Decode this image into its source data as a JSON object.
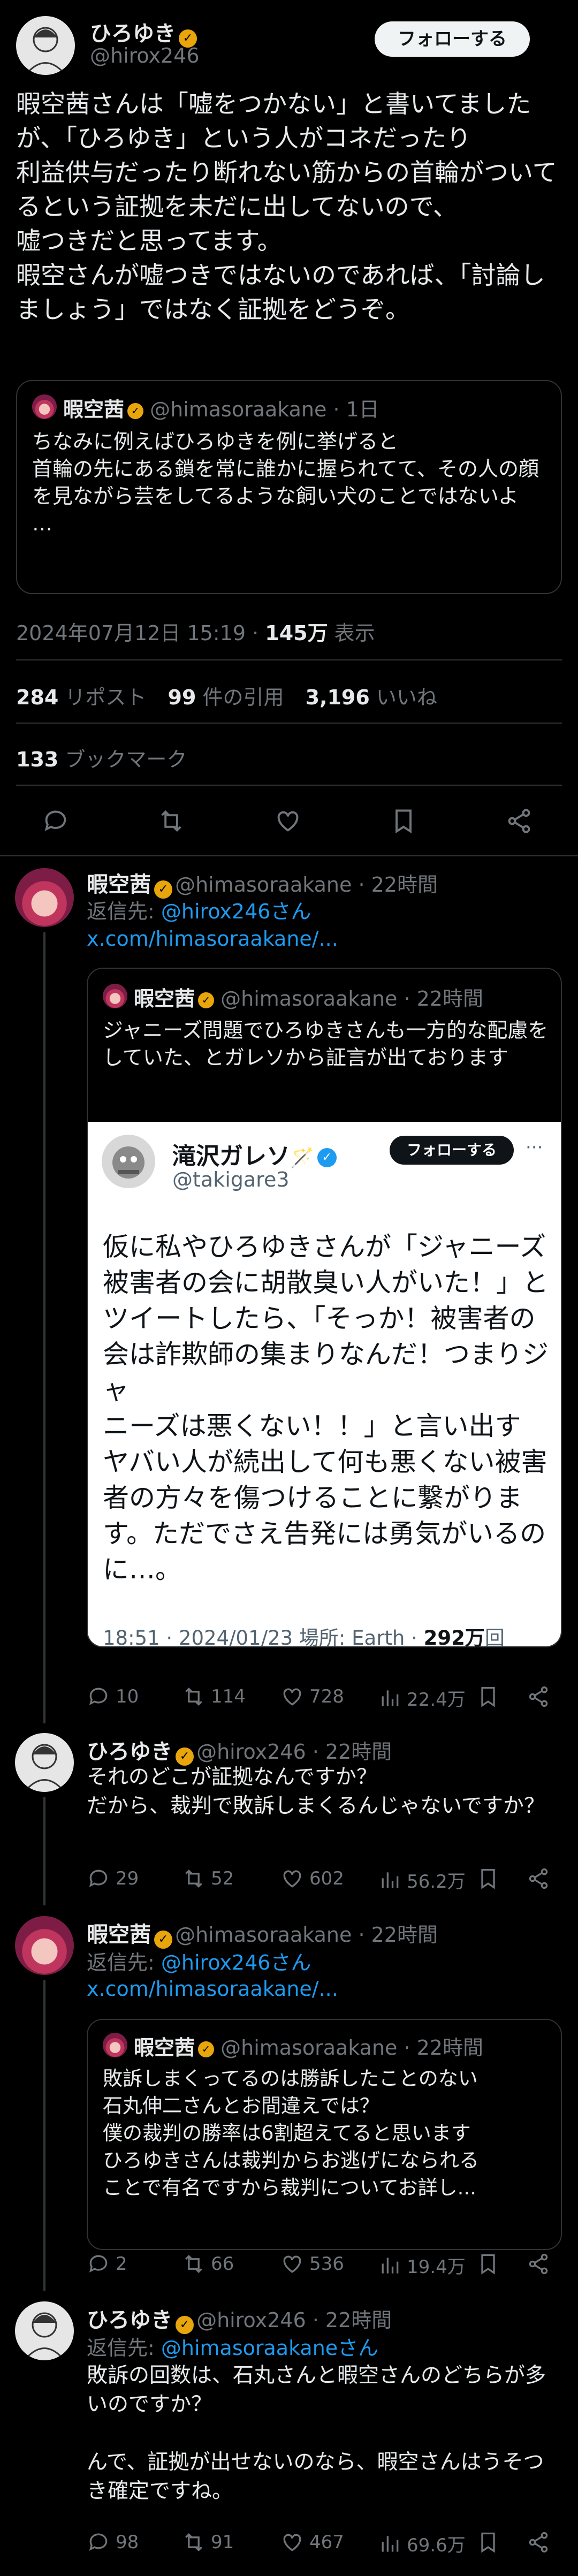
{
  "main_tweet": {
    "author_name": "ひろゆき",
    "handle": "@hirox246",
    "follow_label": "フォローする",
    "text": "暇空茜さんは「嘘をつかない」と書いてましたが、「ひろゆき」という人がコネだったり\n利益供与だったり断れない筋からの首輪がついてるという証拠を未だに出してないので、\n嘘つきだと思ってます。\n暇空さんが嘘つきではないのであれば、「討論しましょう」ではなく証拠をどうぞ。",
    "quote": {
      "author_name": "暇空茜",
      "handle_time": "@himasoraakane · 1日",
      "text": "ちなみに例えばひろゆきを例に挙げると\n首輪の先にある鎖を常に誰かに握られてて、その人の顔を見ながら芸をしてるような飼い犬のことではないよ\n…"
    },
    "timestamp": "2024年07月12日 15:19 · ",
    "views_count": "145万",
    "views_label": " 表示",
    "retweets_count": "284",
    "retweets_label": " リポスト",
    "quotes_count": "99",
    "quotes_label": " 件の引用",
    "likes_count": "3,196",
    "likes_label": " いいね",
    "bookmarks_count": "133",
    "bookmarks_label": " ブックマーク"
  },
  "reply1": {
    "author_name": "暇空茜",
    "handle_time": "@himasoraakane · 22時間",
    "reply_to_prefix": "返信先: ",
    "reply_to": "@hirox246さん",
    "link": "x.com/himasoraakane/...",
    "quote": {
      "author_name": "暇空茜",
      "handle_time": "@himasoraakane · 22時間",
      "text": "ジャニーズ問題でひろゆきさんも一方的な配慮をしていた、とガレソから証言が出ております"
    },
    "embed": {
      "author_name": "滝沢ガレソ",
      "name_emoji": "🪄",
      "handle": "@takigare3",
      "follow_label": "フォローする",
      "more": "···",
      "text": "仮に私やひろゆきさんが「ジャニーズ\n被害者の会に胡散臭い人がいた！」と\nツイートしたら、「そっか！被害者の\n会は詐欺師の集まりなんだ！つまりジャ\nニーズは悪くない！！」と言い出す\nヤバい人が続出して何も悪くない被害\n者の方々を傷つけることに繋がりま\nす。ただでさえ告発には勇気がいるの\nに…。",
      "meta": "18:51 · 2024/01/23 場所: Earth · ",
      "views": "292万",
      "views_suffix": "回"
    },
    "stats": {
      "replies": "10",
      "retweets": "114",
      "likes": "728",
      "views": "22.4万"
    }
  },
  "reply2": {
    "author_name": "ひろゆき",
    "handle_time": "@hirox246 · 22時間",
    "text": "それのどこが証拠なんですか？\nだから、裁判で敗訴しまくるんじゃないですか？",
    "stats": {
      "replies": "29",
      "retweets": "52",
      "likes": "602",
      "views": "56.2万"
    }
  },
  "reply3": {
    "author_name": "暇空茜",
    "handle_time": "@himasoraakane · 22時間",
    "reply_to_prefix": "返信先: ",
    "reply_to": "@hirox246さん",
    "link": "x.com/himasoraakane/...",
    "quote": {
      "author_name": "暇空茜",
      "handle_time": "@himasoraakane · 22時間",
      "text": "敗訴しまくってるのは勝訴したことのない\n石丸伸二さんとお間違えでは？\n僕の裁判の勝率は6割超えてると思います\nひろゆきさんは裁判からお逃げになられる\nことで有名ですから裁判についてお詳し..."
    },
    "stats": {
      "replies": "2",
      "retweets": "66",
      "likes": "536",
      "views": "19.4万"
    }
  },
  "reply4": {
    "author_name": "ひろゆき",
    "handle_time": "@hirox246 · 22時間",
    "reply_to_prefix": "返信先: ",
    "reply_to": "@himasoraakaneさん",
    "text": "敗訴の回数は、石丸さんと暇空さんのどちらが多いのですか？\n\nんで、証拠が出せないのなら、暇空さんはうそつき確定ですね。",
    "stats": {
      "replies": "98",
      "retweets": "91",
      "likes": "467",
      "views": "69.6万"
    }
  },
  "colors": {
    "background": "#000000",
    "text": "#e7e9ea",
    "muted": "#71767b",
    "accent": "#1d9bf0",
    "divider": "#2f3336",
    "badge_gold": "#e8a50c"
  }
}
